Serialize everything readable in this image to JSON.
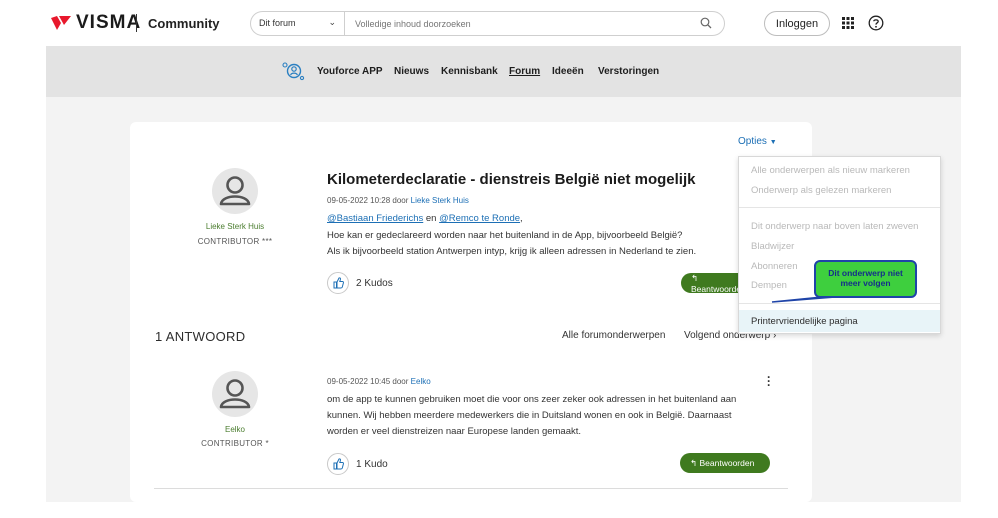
{
  "header": {
    "brand": "VISMA",
    "community": "Community",
    "search_scope": "Dit forum",
    "search_placeholder": "Volledige inhoud doorzoeken",
    "login_label": "Inloggen"
  },
  "nav": {
    "items": [
      "Youforce APP",
      "Nieuws",
      "Kennisbank",
      "Forum",
      "Ideeën",
      "Verstoringen"
    ],
    "active": "Forum"
  },
  "topic": {
    "options_label": "Opties",
    "title": "Kilometerdeclaratie - dienstreis België niet mogelijk",
    "date": "09-05-2022 10:28",
    "by_label": "door",
    "author": "Lieke Sterk Huis",
    "author_rank": "CONTRIBUTOR ***",
    "mention_1": "@Bastiaan Friederichs",
    "mention_joiner": "en",
    "mention_2": "@Remco te Ronde",
    "mention_end": ",",
    "body_line_1": "Hoe kan er gedeclareerd worden naar het buitenland in de App, bijvoorbeeld België?",
    "body_line_2": "Als ik bijvoorbeeld station Antwerpen intyp, krijg ik alleen adressen in Nederland te zien.",
    "kudos": "2 Kudos",
    "reply_label": "Beantwoorden"
  },
  "answers": {
    "heading": "1 ANTWOORD",
    "all_topics": "Alle forumonderwerpen",
    "next_topic": "Volgend onderwerp ›"
  },
  "reply": {
    "date": "09-05-2022 10:45",
    "by_label": "door",
    "author": "Eelko",
    "author_rank": "CONTRIBUTOR *",
    "body_line_1": "om de app te kunnen gebruiken moet die voor ons zeer zeker ook adressen in het buitenland aan",
    "body_line_2": "kunnen. Wij hebben meerdere medewerkers die in Duitsland wonen en ook in België. Daarnaast",
    "body_line_3": "worden er veel dienstreizen naar Europese landen gemaakt.",
    "kudos": "1 Kudo",
    "reply_label": "Beantwoorden"
  },
  "options_menu": {
    "items": [
      "Alle onderwerpen als nieuw markeren",
      "Onderwerp als gelezen markeren",
      "Dit onderwerp naar boven laten zweven",
      "Bladwijzer",
      "Abonneren",
      "Dempen",
      "Printervriendelijke pagina"
    ]
  },
  "callout": {
    "line_1": "Dit onderwerp niet",
    "line_2": "meer volgen"
  },
  "colors": {
    "accent_link": "#1c6fb5",
    "reply_button": "#3f7a1f",
    "author_green": "#4b7d2f",
    "callout_fill": "#3ecf3e",
    "callout_border": "#1f44a8"
  }
}
